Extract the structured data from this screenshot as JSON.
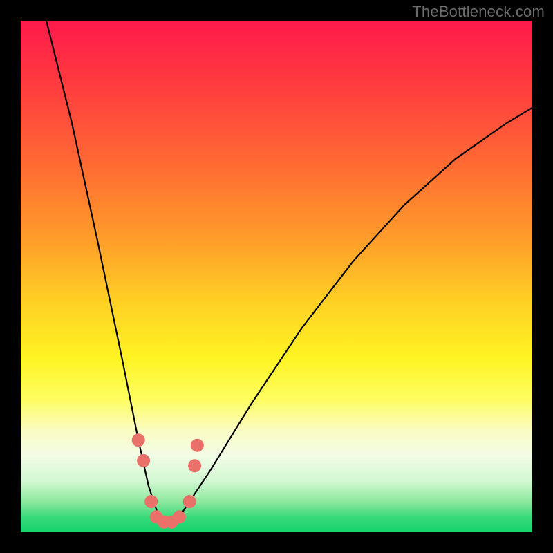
{
  "watermark": "TheBottleneck.com",
  "colors": {
    "frame": "#000000",
    "gradient_top": "#ff1a4b",
    "gradient_bottom": "#14d36b",
    "curve": "#000000",
    "markers": "#e9716a"
  },
  "chart_data": {
    "type": "line",
    "title": "",
    "xlabel": "",
    "ylabel": "",
    "xlim": [
      0,
      100
    ],
    "ylim": [
      0,
      100
    ],
    "grid": false,
    "legend": false,
    "description": "V-shaped bottleneck curve over a vertical red-to-green heat gradient; minimum near x≈28 where the curve touches the green band. Left branch is steep, right branch rises more gradually.",
    "series": [
      {
        "name": "bottleneck-curve",
        "x": [
          5,
          10,
          15,
          20,
          23,
          25,
          27,
          28,
          29,
          31,
          33,
          37,
          45,
          55,
          65,
          75,
          85,
          95,
          100
        ],
        "values": [
          100,
          80,
          57,
          33,
          18,
          9,
          3,
          2,
          2,
          3,
          6,
          12,
          25,
          40,
          53,
          64,
          73,
          80,
          83
        ]
      }
    ],
    "markers": {
      "comment": "Salmon dots clustered near the curve minimum",
      "points": [
        {
          "x": 23,
          "y": 18
        },
        {
          "x": 24,
          "y": 14
        },
        {
          "x": 25.5,
          "y": 6
        },
        {
          "x": 26.5,
          "y": 3
        },
        {
          "x": 28,
          "y": 2
        },
        {
          "x": 29.5,
          "y": 2
        },
        {
          "x": 31,
          "y": 3
        },
        {
          "x": 33,
          "y": 6
        },
        {
          "x": 34,
          "y": 13
        },
        {
          "x": 34.5,
          "y": 17
        }
      ],
      "radius_px": 9
    }
  }
}
